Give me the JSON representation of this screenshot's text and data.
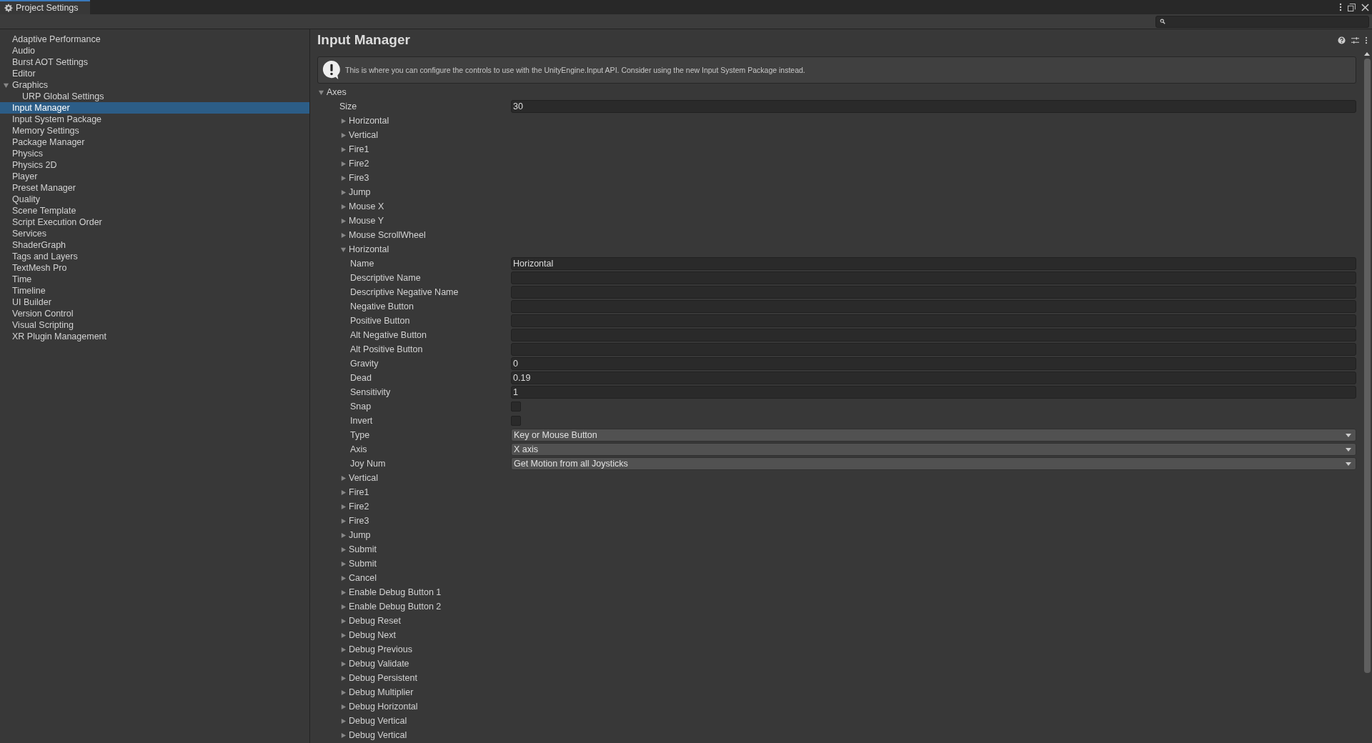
{
  "window": {
    "title": "Project Settings"
  },
  "sidebar": {
    "items": [
      {
        "label": "Adaptive Performance",
        "selected": false
      },
      {
        "label": "Audio",
        "selected": false
      },
      {
        "label": "Burst AOT Settings",
        "selected": false
      },
      {
        "label": "Editor",
        "selected": false
      },
      {
        "label": "Graphics",
        "selected": false,
        "expanded": true,
        "children": [
          {
            "label": "URP Global Settings",
            "selected": false
          }
        ]
      },
      {
        "label": "Input Manager",
        "selected": true
      },
      {
        "label": "Input System Package",
        "selected": false
      },
      {
        "label": "Memory Settings",
        "selected": false
      },
      {
        "label": "Package Manager",
        "selected": false
      },
      {
        "label": "Physics",
        "selected": false
      },
      {
        "label": "Physics 2D",
        "selected": false
      },
      {
        "label": "Player",
        "selected": false
      },
      {
        "label": "Preset Manager",
        "selected": false
      },
      {
        "label": "Quality",
        "selected": false
      },
      {
        "label": "Scene Template",
        "selected": false
      },
      {
        "label": "Script Execution Order",
        "selected": false
      },
      {
        "label": "Services",
        "selected": false
      },
      {
        "label": "ShaderGraph",
        "selected": false
      },
      {
        "label": "Tags and Layers",
        "selected": false
      },
      {
        "label": "TextMesh Pro",
        "selected": false
      },
      {
        "label": "Time",
        "selected": false
      },
      {
        "label": "Timeline",
        "selected": false
      },
      {
        "label": "UI Builder",
        "selected": false
      },
      {
        "label": "Version Control",
        "selected": false
      },
      {
        "label": "Visual Scripting",
        "selected": false
      },
      {
        "label": "XR Plugin Management",
        "selected": false
      }
    ]
  },
  "panel": {
    "title": "Input Manager",
    "help_box": {
      "text": "This is where you can configure the controls to use with the UnityEngine.Input API. Consider using the new Input System Package instead."
    },
    "axes": {
      "label": "Axes",
      "expanded": true,
      "size": {
        "label": "Size",
        "value": "30"
      },
      "items": [
        {
          "name": "Horizontal",
          "expanded": false
        },
        {
          "name": "Vertical",
          "expanded": false
        },
        {
          "name": "Fire1",
          "expanded": false
        },
        {
          "name": "Fire2",
          "expanded": false
        },
        {
          "name": "Fire3",
          "expanded": false
        },
        {
          "name": "Jump",
          "expanded": false
        },
        {
          "name": "Mouse X",
          "expanded": false
        },
        {
          "name": "Mouse Y",
          "expanded": false
        },
        {
          "name": "Mouse ScrollWheel",
          "expanded": false
        },
        {
          "name": "Horizontal",
          "expanded": true,
          "fields": [
            {
              "kind": "text",
              "label": "Name",
              "value": "Horizontal"
            },
            {
              "kind": "text",
              "label": "Descriptive Name"
            },
            {
              "kind": "text",
              "label": "Descriptive Negative Name"
            },
            {
              "kind": "text",
              "label": "Negative Button"
            },
            {
              "kind": "text",
              "label": "Positive Button"
            },
            {
              "kind": "text",
              "label": "Alt Negative Button"
            },
            {
              "kind": "text",
              "label": "Alt Positive Button"
            },
            {
              "kind": "text",
              "label": "Gravity",
              "value": "0"
            },
            {
              "kind": "text",
              "label": "Dead",
              "value": "0.19"
            },
            {
              "kind": "text",
              "label": "Sensitivity",
              "value": "1"
            },
            {
              "kind": "checkbox",
              "label": "Snap",
              "checked": false
            },
            {
              "kind": "checkbox",
              "label": "Invert",
              "checked": false
            },
            {
              "kind": "dropdown",
              "label": "Type",
              "value": "Key or Mouse Button"
            },
            {
              "kind": "dropdown",
              "label": "Axis",
              "value": "X axis"
            },
            {
              "kind": "dropdown",
              "label": "Joy Num",
              "value": "Get Motion from all Joysticks"
            }
          ]
        },
        {
          "name": "Vertical",
          "expanded": false
        },
        {
          "name": "Fire1",
          "expanded": false
        },
        {
          "name": "Fire2",
          "expanded": false
        },
        {
          "name": "Fire3",
          "expanded": false
        },
        {
          "name": "Jump",
          "expanded": false
        },
        {
          "name": "Submit",
          "expanded": false
        },
        {
          "name": "Submit",
          "expanded": false
        },
        {
          "name": "Cancel",
          "expanded": false
        },
        {
          "name": "Enable Debug Button 1",
          "expanded": false
        },
        {
          "name": "Enable Debug Button 2",
          "expanded": false
        },
        {
          "name": "Debug Reset",
          "expanded": false
        },
        {
          "name": "Debug Next",
          "expanded": false
        },
        {
          "name": "Debug Previous",
          "expanded": false
        },
        {
          "name": "Debug Validate",
          "expanded": false
        },
        {
          "name": "Debug Persistent",
          "expanded": false
        },
        {
          "name": "Debug Multiplier",
          "expanded": false
        },
        {
          "name": "Debug Horizontal",
          "expanded": false
        },
        {
          "name": "Debug Vertical",
          "expanded": false
        },
        {
          "name": "Debug Vertical",
          "expanded": false
        }
      ]
    }
  }
}
